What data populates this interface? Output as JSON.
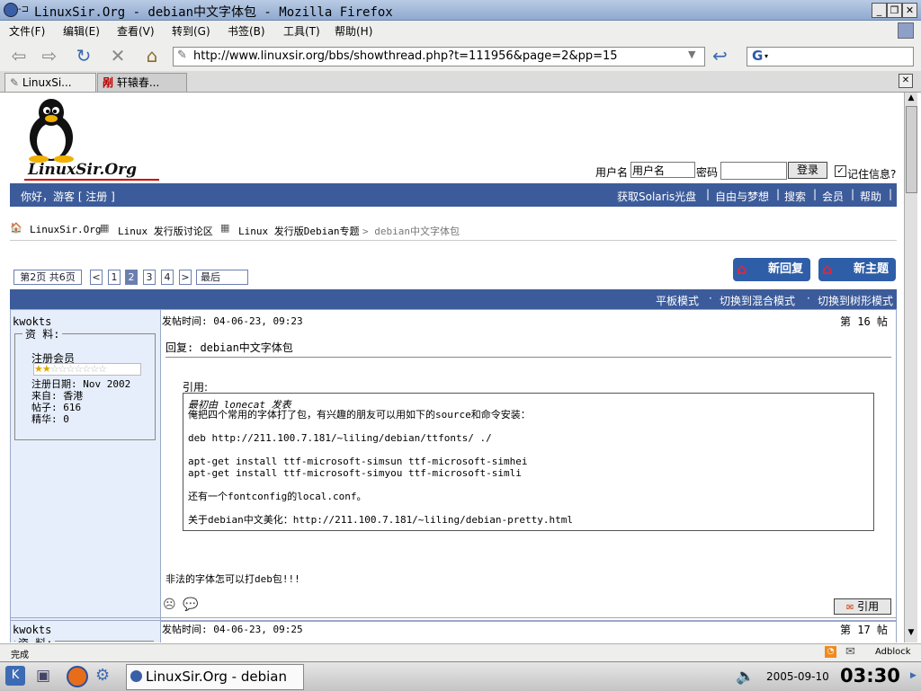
{
  "window": {
    "title": "LinuxSir.Org - debian中文字体包 - Mozilla Firefox"
  },
  "menu": [
    "文件(F)",
    "编辑(E)",
    "查看(V)",
    "转到(G)",
    "书签(B)",
    "工具(T)",
    "帮助(H)"
  ],
  "address": {
    "url": "http://www.linuxsir.org/bbs/showthread.php?t=111956&page=2&pp=15",
    "search_icon": "G"
  },
  "tabs": [
    {
      "label": "LinuxSi..."
    },
    {
      "label": "轩辕春..."
    }
  ],
  "site": {
    "logo_text": "LinuxSir.Org",
    "login": {
      "username_label": "用户名",
      "username_value": "用户名",
      "password_label": "密码",
      "login_button": "登录",
      "remember_label": "记住信息?"
    },
    "topbar": {
      "greeting": "你好，游客 [ 注册 ]",
      "links": [
        "获取Solaris光盘",
        "自由与梦想",
        "搜索",
        "会员",
        "帮助"
      ]
    },
    "breadcrumb": {
      "home": "LinuxSir.Org",
      "forum": "Linux 发行版讨论区",
      "sub": "Linux 发行版Debian专题",
      "current": "> debian中文字体包"
    },
    "pager": {
      "label": "第2页 共6页",
      "prev": "<",
      "pages": [
        "1",
        "2",
        "3",
        "4"
      ],
      "next": ">",
      "last": "最后"
    },
    "buttons": {
      "new_reply": "新回复",
      "new_thread": "新主题"
    },
    "modes": {
      "flat": "平板模式",
      "hybrid": "切换到混合模式",
      "threaded": "切换到树形模式"
    }
  },
  "posts": [
    {
      "author": "kwokts",
      "profile_label": "资 料:",
      "rank": "注册会员",
      "rating": 2,
      "rating_max": 9,
      "join_date": "注册日期: Nov 2002",
      "location": "来自: 香港",
      "posts_count": "帖子: 616",
      "essence": "精华: 0",
      "time": "发帖时间: 04-06-23, 09:23",
      "number": "第 16 帖",
      "subject": "回复: debian中文字体包",
      "quote_label": "引用:",
      "quote_author": "最初由 lonecat 发表",
      "quote_lines": [
        "俺把四个常用的字体打了包，有兴趣的朋友可以用如下的source和命令安装：",
        "",
        "deb http://211.100.7.181/~liling/debian/ttfonts/ ./",
        "",
        "apt-get install ttf-microsoft-simsun ttf-microsoft-simhei",
        "apt-get install ttf-microsoft-simyou ttf-microsoft-simli",
        "",
        "还有一个fontconfig的local.conf。",
        "",
        "关于debian中文美化：http://211.100.7.181/~liling/debian-pretty.html"
      ],
      "body": "非法的字体怎可以打deb包!!!",
      "quote_button": "引用"
    },
    {
      "author": "kwokts",
      "profile_label": "资 料:",
      "time": "发帖时间: 04-06-23, 09:25",
      "number": "第 17 帖"
    }
  ],
  "status": {
    "text": "完成",
    "adblock": "Adblock"
  },
  "taskbar": {
    "window_label": "LinuxSir.Org - debian",
    "date": "2005-09-10",
    "time": "03:30"
  },
  "colors": {
    "accent": "#3c5b9a",
    "post_side": "#e6eefb",
    "panel": "#eeeeec"
  }
}
